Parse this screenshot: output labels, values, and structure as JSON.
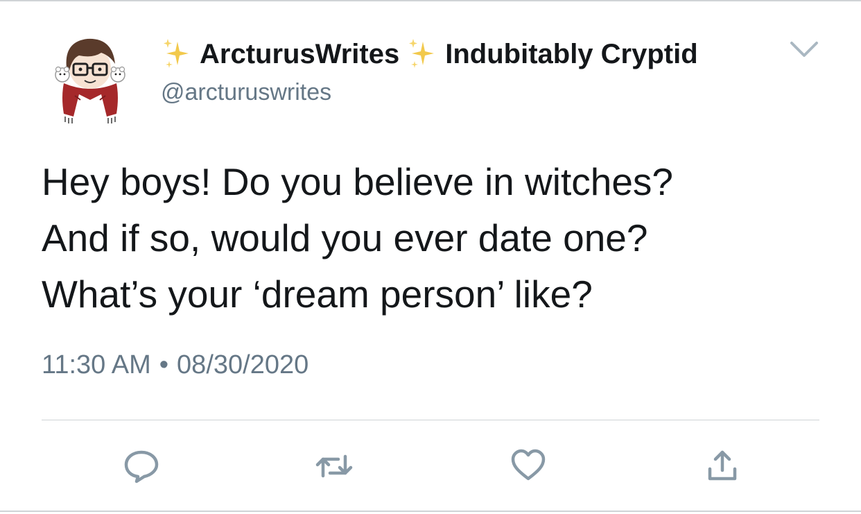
{
  "tweet": {
    "display_name": "ArcturusWrites",
    "display_name_suffix": "Indubitably Cryptid",
    "name_emoji": "sparkles-icon",
    "handle": "@arcturuswrites",
    "text_lines": [
      "Hey boys! Do you believe in witches?",
      "And if so, would you ever date one?",
      "What’s your ‘dream person’ like?"
    ],
    "time": "11:30 AM",
    "separator": "•",
    "date": "08/30/2020"
  },
  "actions": [
    {
      "icon": "reply-icon"
    },
    {
      "icon": "retweet-icon"
    },
    {
      "icon": "like-icon"
    },
    {
      "icon": "share-icon"
    }
  ],
  "colors": {
    "text": "#14171a",
    "secondary": "#657786",
    "icon": "#8899a6",
    "sparkle": "#f2c94c",
    "divider": "#cfd3d6"
  }
}
